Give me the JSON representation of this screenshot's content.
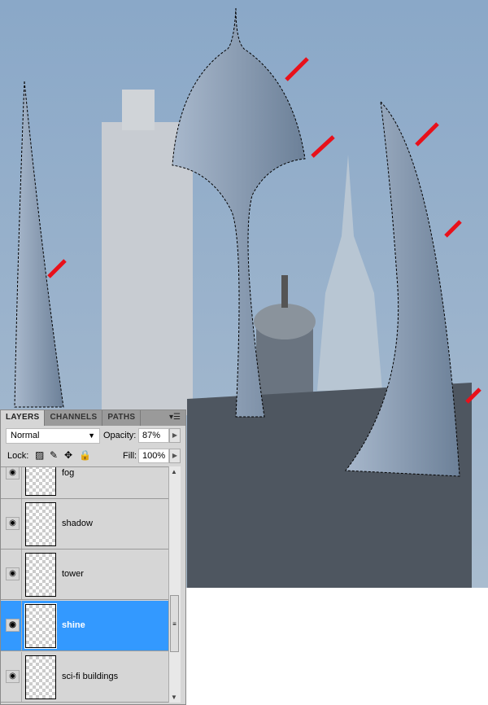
{
  "panel": {
    "tabs": [
      "LAYERS",
      "CHANNELS",
      "PATHS"
    ],
    "active_tab": "LAYERS",
    "blend_mode": "Normal",
    "opacity_label": "Opacity:",
    "opacity": "87%",
    "lock_label": "Lock:",
    "fill_label": "Fill:",
    "fill": "100%",
    "layers": [
      {
        "name": "fog",
        "visible": true,
        "selected": false
      },
      {
        "name": "shadow",
        "visible": true,
        "selected": false
      },
      {
        "name": "tower",
        "visible": true,
        "selected": false
      },
      {
        "name": "shine",
        "visible": true,
        "selected": true
      },
      {
        "name": "sci-fi buildings",
        "visible": true,
        "selected": false
      }
    ]
  },
  "colors": {
    "selection": "#3399ff",
    "arrow": "#e8101a",
    "sky": "#8aa6c4"
  }
}
